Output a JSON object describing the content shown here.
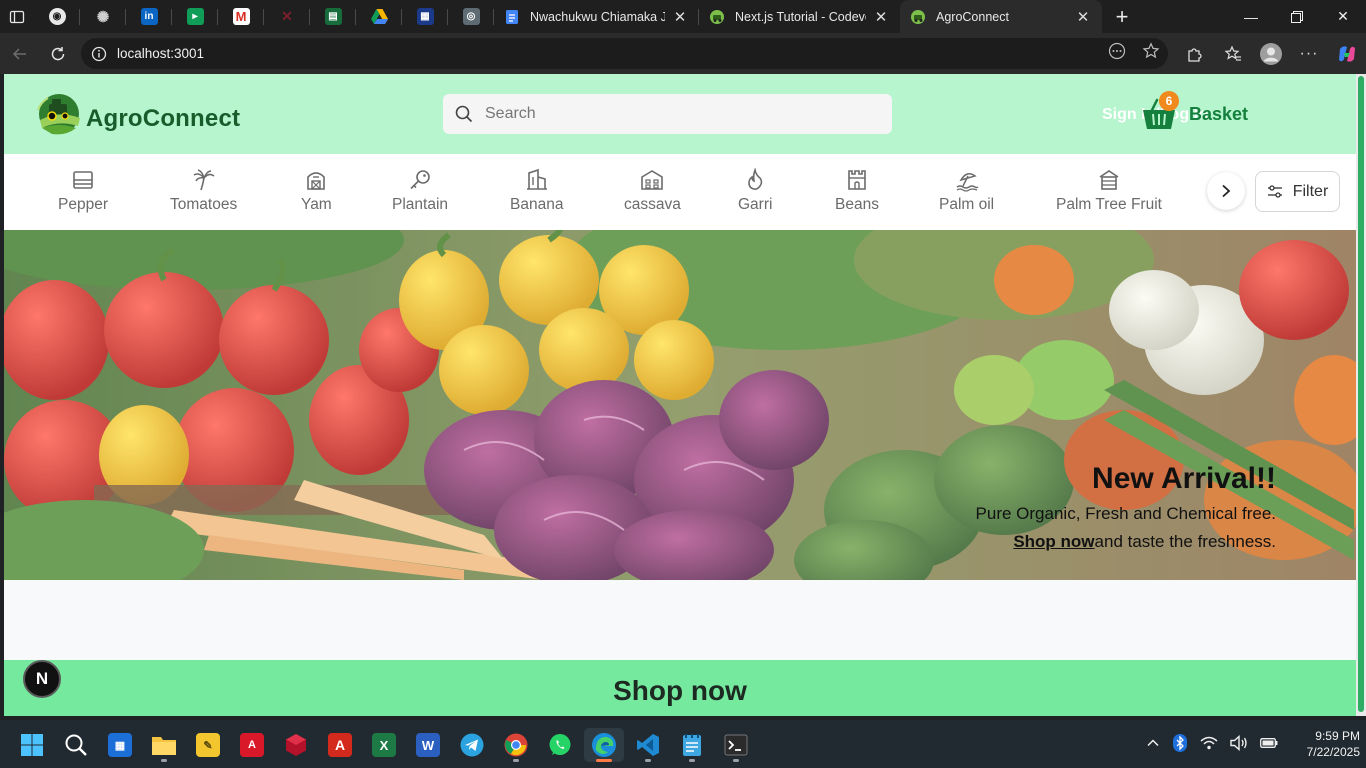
{
  "browser": {
    "pinned_tabs": [
      "github-icon",
      "openai-icon",
      "linkedin-icon",
      "meet-icon",
      "gmail-icon",
      "app-icon",
      "sheets-icon",
      "drive-icon",
      "app-icon",
      "app-icon"
    ],
    "tabs": [
      {
        "title": "Nwachukwu Chiamaka Juli",
        "icon": "docs-icon",
        "active": false
      },
      {
        "title": "Next.js Tutorial - Codevolu",
        "icon": "site-icon",
        "active": false
      },
      {
        "title": "AgroConnect",
        "icon": "site-icon",
        "active": true
      }
    ],
    "url": "localhost:3001"
  },
  "site": {
    "brand": "AgroConnect",
    "search_placeholder": "Search",
    "signin": "Sign In/Log In",
    "basket_count": "6",
    "basket_label": "Basket",
    "categories": [
      "Pepper",
      "Tomatoes",
      "Yam",
      "Plantain",
      "Banana",
      "cassava",
      "Garri",
      "Beans",
      "Palm oil",
      "Palm Tree Fruit"
    ],
    "filter_label": "Filter",
    "hero": {
      "title": "New Arrival!!",
      "subtitle": "Pure Organic, Fresh and Chemical free.",
      "link": "Shop now",
      "line_rest": "and taste the freshness."
    },
    "shop_heading": "Shop now",
    "dev_badge": "N"
  },
  "taskbar": {
    "apps": [
      "start-icon",
      "search-icon",
      "store-icon",
      "file-explorer-icon",
      "notes-icon",
      "autocad-icon",
      "cube-icon",
      "acrobat-icon",
      "excel-icon",
      "word-icon",
      "telegram-icon",
      "chrome-icon",
      "whatsapp-icon",
      "edge-icon",
      "vscode-icon",
      "notepad-icon",
      "terminal-icon"
    ],
    "time": "9:59 PM",
    "date": "7/22/2025"
  },
  "colors": {
    "header_bg": "#b6f5cd",
    "brand_green": "#185c2c",
    "basket_badge": "#f08a1c",
    "shop_strip": "#75ea9f"
  }
}
